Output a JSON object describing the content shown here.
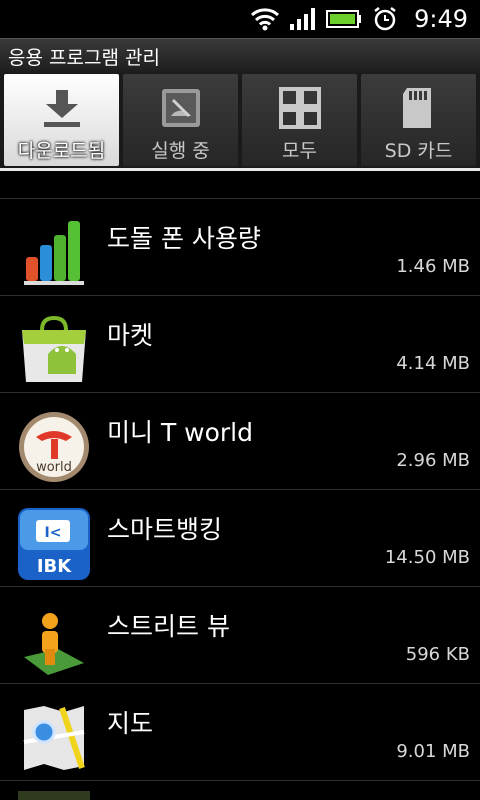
{
  "status": {
    "time": "9:49"
  },
  "header": {
    "title": "응용 프로그램 관리"
  },
  "tabs": [
    {
      "label": "다운로드됨",
      "icon": "download-icon",
      "active": true
    },
    {
      "label": "실행 중",
      "icon": "running-icon",
      "active": false
    },
    {
      "label": "모두",
      "icon": "grid-icon",
      "active": false
    },
    {
      "label": "SD 카드",
      "icon": "sd-card-icon",
      "active": false
    }
  ],
  "apps": [
    {
      "name": "도돌 폰 사용량",
      "size": "1.46 MB",
      "icon": "bar-chart-app-icon"
    },
    {
      "name": "마켓",
      "size": "4.14 MB",
      "icon": "android-market-icon"
    },
    {
      "name": "미니 T world",
      "size": "2.96 MB",
      "icon": "t-world-icon"
    },
    {
      "name": "스마트뱅킹",
      "size": "14.50 MB",
      "icon": "ibk-bank-icon"
    },
    {
      "name": "스트리트 뷰",
      "size": "596 KB",
      "icon": "street-view-icon"
    },
    {
      "name": "지도",
      "size": "9.01 MB",
      "icon": "maps-icon"
    }
  ],
  "colors": {
    "background": "#000000",
    "active_tab": "#ffffff",
    "divider": "#2e2e2e"
  }
}
